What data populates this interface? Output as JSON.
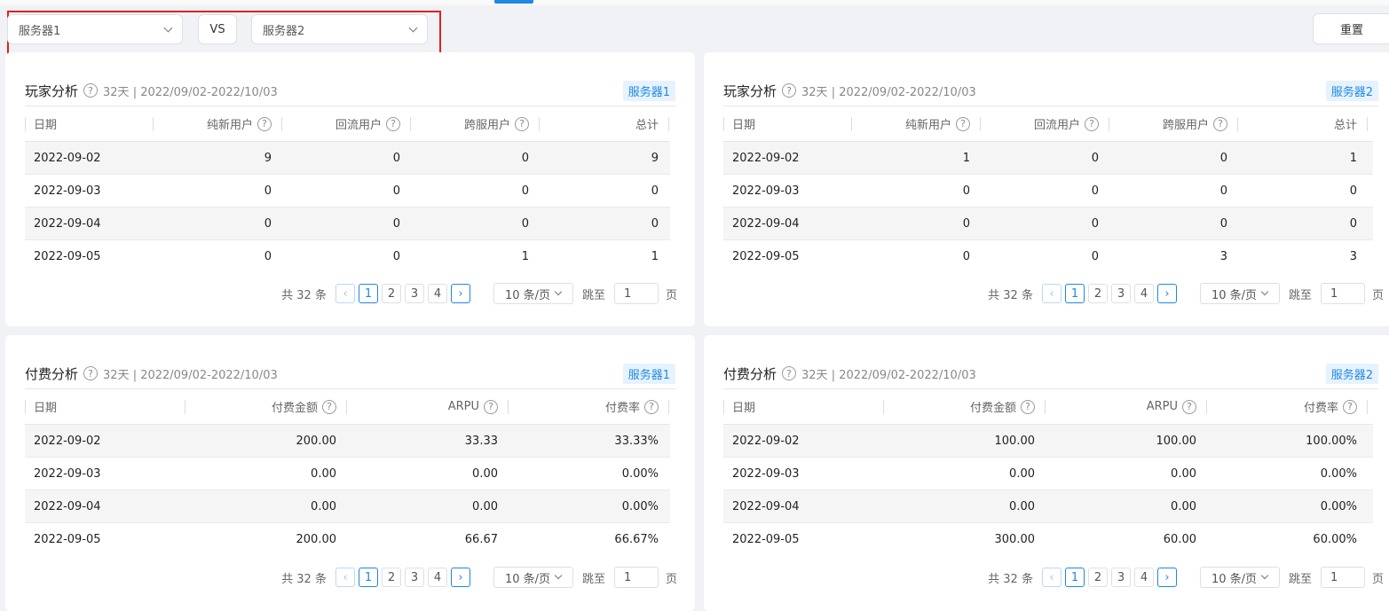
{
  "toolbar": {
    "server_left": "服务器1",
    "vs_label": "VS",
    "server_right": "服务器2",
    "reset_label": "重置"
  },
  "player_left": {
    "title": "玩家分析",
    "help": "?",
    "subtitle": "32天 | 2022/09/02-2022/10/03",
    "server_tag": "服务器1",
    "columns": [
      "日期",
      "纯新用户",
      "回流用户",
      "跨服用户",
      "总计"
    ],
    "rows": [
      [
        "2022-09-02",
        "9",
        "0",
        "0",
        "9"
      ],
      [
        "2022-09-03",
        "0",
        "0",
        "0",
        "0"
      ],
      [
        "2022-09-04",
        "0",
        "0",
        "0",
        "0"
      ],
      [
        "2022-09-05",
        "0",
        "0",
        "1",
        "1"
      ]
    ],
    "pagination": {
      "total": "共 32 条",
      "prev": "‹",
      "next": "›",
      "pages": [
        "1",
        "2",
        "3",
        "4"
      ],
      "page_size": "10 条/页",
      "jump_label": "跳至",
      "jump_value": "1",
      "page_unit": "页"
    }
  },
  "player_right": {
    "title": "玩家分析",
    "help": "?",
    "subtitle": "32天 | 2022/09/02-2022/10/03",
    "server_tag": "服务器2",
    "columns": [
      "日期",
      "纯新用户",
      "回流用户",
      "跨服用户",
      "总计"
    ],
    "rows": [
      [
        "2022-09-02",
        "1",
        "0",
        "0",
        "1"
      ],
      [
        "2022-09-03",
        "0",
        "0",
        "0",
        "0"
      ],
      [
        "2022-09-04",
        "0",
        "0",
        "0",
        "0"
      ],
      [
        "2022-09-05",
        "0",
        "0",
        "3",
        "3"
      ]
    ],
    "pagination": {
      "total": "共 32 条",
      "prev": "‹",
      "next": "›",
      "pages": [
        "1",
        "2",
        "3",
        "4"
      ],
      "page_size": "10 条/页",
      "jump_label": "跳至",
      "jump_value": "1",
      "page_unit": "页"
    }
  },
  "pay_left": {
    "title": "付费分析",
    "help": "?",
    "subtitle": "32天 | 2022/09/02-2022/10/03",
    "server_tag": "服务器1",
    "columns": [
      "日期",
      "付费金额",
      "ARPU",
      "付费率"
    ],
    "rows": [
      [
        "2022-09-02",
        "200.00",
        "33.33",
        "33.33%"
      ],
      [
        "2022-09-03",
        "0.00",
        "0.00",
        "0.00%"
      ],
      [
        "2022-09-04",
        "0.00",
        "0.00",
        "0.00%"
      ],
      [
        "2022-09-05",
        "200.00",
        "66.67",
        "66.67%"
      ]
    ],
    "pagination": {
      "total": "共 32 条",
      "prev": "‹",
      "next": "›",
      "pages": [
        "1",
        "2",
        "3",
        "4"
      ],
      "page_size": "10 条/页",
      "jump_label": "跳至",
      "jump_value": "1",
      "page_unit": "页"
    }
  },
  "pay_right": {
    "title": "付费分析",
    "help": "?",
    "subtitle": "32天 | 2022/09/02-2022/10/03",
    "server_tag": "服务器2",
    "columns": [
      "日期",
      "付费金额",
      "ARPU",
      "付费率"
    ],
    "rows": [
      [
        "2022-09-02",
        "100.00",
        "100.00",
        "100.00%"
      ],
      [
        "2022-09-03",
        "0.00",
        "0.00",
        "0.00%"
      ],
      [
        "2022-09-04",
        "0.00",
        "0.00",
        "0.00%"
      ],
      [
        "2022-09-05",
        "300.00",
        "60.00",
        "60.00%"
      ]
    ],
    "pagination": {
      "total": "共 32 条",
      "prev": "‹",
      "next": "›",
      "pages": [
        "1",
        "2",
        "3",
        "4"
      ],
      "page_size": "10 条/页",
      "jump_label": "跳至",
      "jump_value": "1",
      "page_unit": "页"
    }
  },
  "colors": {
    "accent": "#1e88e5",
    "highlight": "#e02020",
    "row_alt": "#f5f5f5"
  }
}
